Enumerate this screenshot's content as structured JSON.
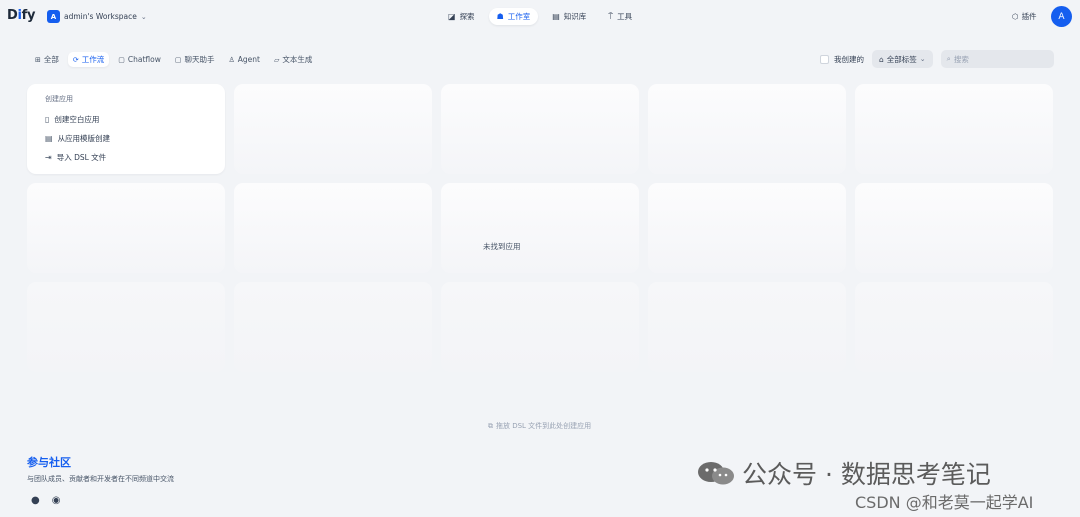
{
  "app": {
    "logo_text": "Dify",
    "workspace_initial": "A",
    "workspace_name": "admin's Workspace",
    "user_initial": "A",
    "plugin_label": "插件"
  },
  "nav": [
    {
      "label": "探索",
      "icon": "compass-icon",
      "active": false
    },
    {
      "label": "工作室",
      "icon": "robot-icon",
      "active": true
    },
    {
      "label": "知识库",
      "icon": "book-icon",
      "active": false
    },
    {
      "label": "工具",
      "icon": "hammer-icon",
      "active": false
    }
  ],
  "filters": [
    {
      "label": "全部",
      "icon": "grid-icon",
      "active": false
    },
    {
      "label": "工作流",
      "icon": "workflow-icon",
      "active": true
    },
    {
      "label": "Chatflow",
      "icon": "chatflow-icon",
      "active": false
    },
    {
      "label": "聊天助手",
      "icon": "chat-icon",
      "active": false
    },
    {
      "label": "Agent",
      "icon": "agent-icon",
      "active": false
    },
    {
      "label": "文本生成",
      "icon": "text-icon",
      "active": false
    }
  ],
  "toolbar": {
    "my_created_label": "我创建的",
    "tags_label": "全部标签",
    "search_placeholder": "搜索"
  },
  "create_card": {
    "title": "创建应用",
    "items": [
      {
        "label": "创建空白应用",
        "icon": "file-blank-icon"
      },
      {
        "label": "从应用模版创建",
        "icon": "file-template-icon"
      },
      {
        "label": "导入 DSL 文件",
        "icon": "import-icon"
      }
    ]
  },
  "empty_text": "未找到应用",
  "drop_hint": "拖放 DSL 文件到此处创建应用",
  "community": {
    "title": "参与社区",
    "subtitle": "与团队成员、贡献者和开发者在不同频道中交流"
  },
  "watermarks": {
    "line1": "公众号 · 数据思考笔记",
    "line2": "CSDN @和老莫一起学AI"
  }
}
